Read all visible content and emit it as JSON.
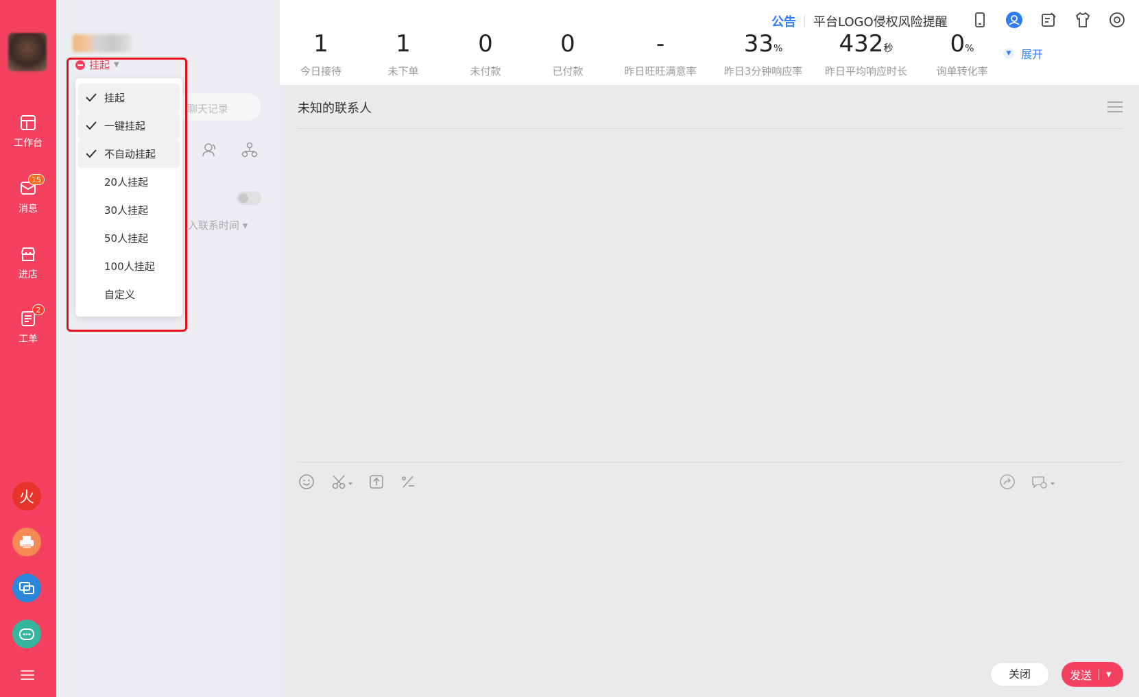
{
  "sidebar": {
    "items": [
      {
        "label": "工作台",
        "icon": "workbench-icon",
        "badge": ""
      },
      {
        "label": "消息",
        "icon": "message-icon",
        "badge": "15"
      },
      {
        "label": "进店",
        "icon": "store-icon",
        "badge": ""
      },
      {
        "label": "工单",
        "icon": "ticket-icon",
        "badge": "2"
      }
    ],
    "apps": [
      {
        "icon": "fire-app-icon",
        "glyph": "火",
        "color": "#e8332a"
      },
      {
        "icon": "printer-app-icon",
        "glyph": "",
        "color": "#f58a55"
      },
      {
        "icon": "chat-app-icon",
        "glyph": "",
        "color": "#2a86d8"
      },
      {
        "icon": "bot-app-icon",
        "glyph": "",
        "color": "#35b59e"
      }
    ],
    "accent": "#f3415f"
  },
  "status": {
    "label": "挂起"
  },
  "dropdown": {
    "items": [
      {
        "label": "挂起",
        "checked": true
      },
      {
        "label": "一键挂起",
        "checked": true
      },
      {
        "label": "不自动挂起",
        "checked": true
      },
      {
        "label": "20人挂起",
        "checked": false
      },
      {
        "label": "30人挂起",
        "checked": false
      },
      {
        "label": "50人挂起",
        "checked": false
      },
      {
        "label": "100人挂起",
        "checked": false
      },
      {
        "label": "自定义",
        "checked": false
      }
    ]
  },
  "middle": {
    "search_placeholder": "聊天记录",
    "sort_label": "入联系时间 ▾"
  },
  "stats": [
    {
      "value": "1",
      "unit": "",
      "label": "今日接待"
    },
    {
      "value": "1",
      "unit": "",
      "label": "未下单"
    },
    {
      "value": "0",
      "unit": "",
      "label": "未付款"
    },
    {
      "value": "0",
      "unit": "",
      "label": "已付款"
    },
    {
      "value": "-",
      "unit": "",
      "label": "昨日旺旺满意率"
    },
    {
      "value": "33",
      "unit": "%",
      "label": "昨日3分钟响应率"
    },
    {
      "value": "432",
      "unit": "秒",
      "label": "昨日平均响应时长"
    },
    {
      "value": "0",
      "unit": "%",
      "label": "询单转化率"
    }
  ],
  "topbar": {
    "notice_tag": "公告",
    "notice_text": "平台LOGO侵权风险提醒",
    "expand_label": "展开"
  },
  "chat": {
    "title": "未知的联系人",
    "close_label": "关闭",
    "send_label": "发送"
  }
}
